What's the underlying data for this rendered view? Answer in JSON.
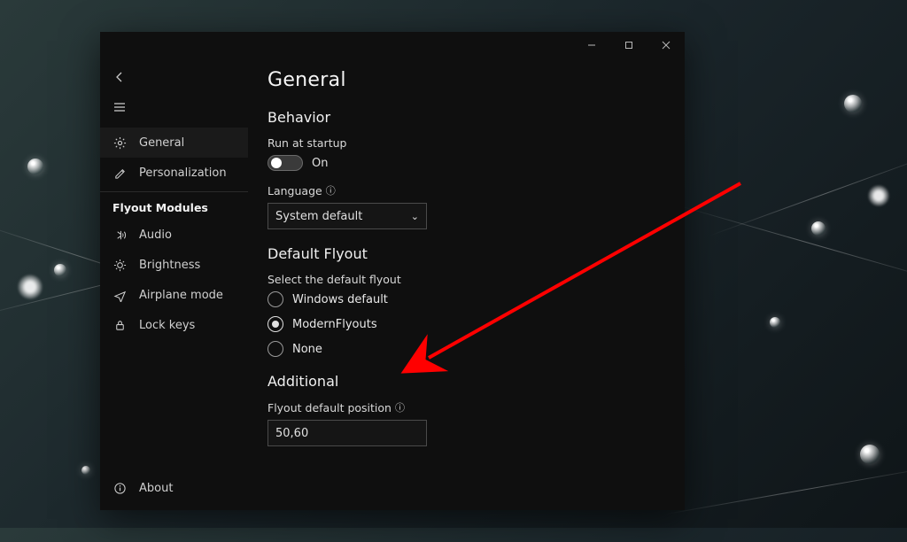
{
  "page": {
    "title": "General"
  },
  "titlebar": {
    "minimize": "—",
    "maximize": "▢",
    "close": "✕"
  },
  "sidebar": {
    "items": [
      {
        "icon": "gear",
        "label": "General"
      },
      {
        "icon": "brush",
        "label": "Personalization"
      }
    ],
    "modules_header": "Flyout Modules",
    "modules": [
      {
        "icon": "audio",
        "label": "Audio"
      },
      {
        "icon": "sun",
        "label": "Brightness"
      },
      {
        "icon": "airplane",
        "label": "Airplane mode"
      },
      {
        "icon": "lock",
        "label": "Lock keys"
      }
    ],
    "about": {
      "icon": "info",
      "label": "About"
    }
  },
  "sections": {
    "behavior": {
      "title": "Behavior",
      "run_at_startup_label": "Run at startup",
      "toggle_state": "On",
      "language_label": "Language",
      "language_value": "System default"
    },
    "default_flyout": {
      "title": "Default Flyout",
      "subtitle": "Select the default flyout",
      "options": [
        "Windows default",
        "ModernFlyouts",
        "None"
      ],
      "selected_index": 1
    },
    "additional": {
      "title": "Additional",
      "position_label": "Flyout default position",
      "position_value": "50,60"
    }
  },
  "colors": {
    "bg_dark": "#0f0f0f",
    "fg": "#e8e8e8",
    "arrow": "#ff0000"
  }
}
